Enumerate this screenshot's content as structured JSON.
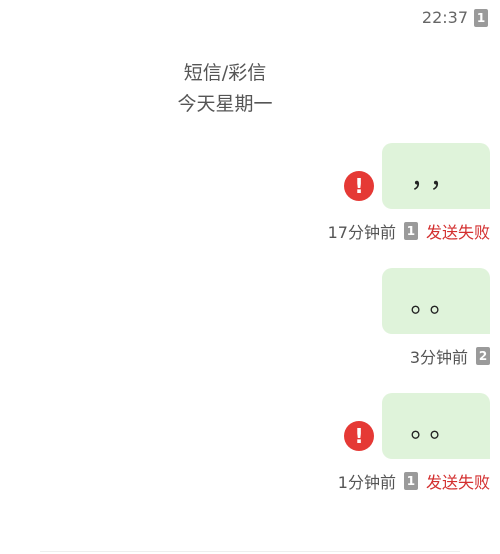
{
  "top": {
    "time": "22:37",
    "sim": "1"
  },
  "header": {
    "title": "短信/彩信",
    "date": "今天星期一"
  },
  "messages": [
    {
      "text": "，，",
      "time_ago": "17分钟前",
      "sim": "1",
      "status": "发送失败",
      "failed": true
    },
    {
      "text": "。。",
      "time_ago": "3分钟前",
      "sim": "2",
      "status": "",
      "failed": false
    },
    {
      "text": "。。",
      "time_ago": "1分钟前",
      "sim": "1",
      "status": "发送失败",
      "failed": true
    }
  ],
  "icons": {
    "error": "error-icon",
    "sim": "sim-card-icon"
  },
  "colors": {
    "bubble": "#dff3da",
    "error": "#e53935",
    "fail_text": "#d32f2f",
    "badge": "#9a9a9a"
  }
}
